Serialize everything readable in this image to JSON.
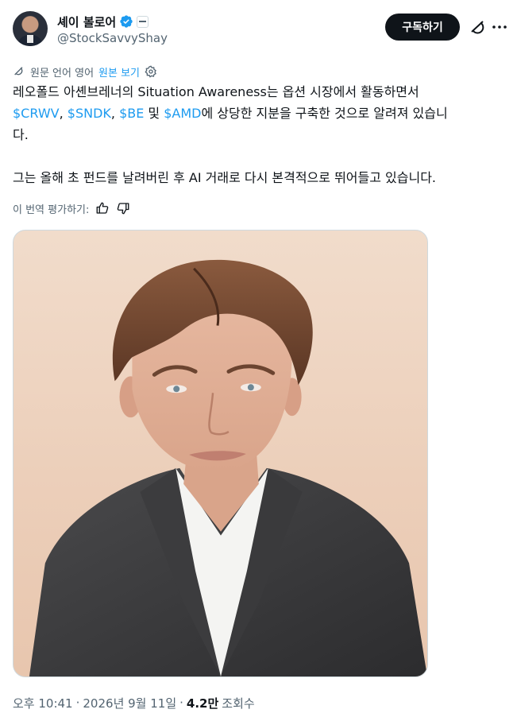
{
  "author": {
    "name": "셰이 볼로어",
    "handle": "@StockSavvyShay"
  },
  "actions": {
    "subscribe_label": "구독하기"
  },
  "translation": {
    "source_label": "원문 언어 영어",
    "show_original": "원본 보기"
  },
  "tweet": {
    "line1": "레오폴드 아셴브레너의 Situation Awareness는 옵션 시장에서 활동하면서",
    "cashtags": [
      "$CRWV",
      "$SNDK",
      "$BE",
      "$AMD"
    ],
    "sep_comma": ", ",
    "and_word": " 및 ",
    "line2_tail": "에 상당한 지분을 구축한 것으로 알려져 있습니",
    "line3": "다.",
    "paragraph2": "그는 올해 초 펀드를 날려버린 후 AI 거래로 다시 본격적으로 뛰어들고 있습니다."
  },
  "rate": {
    "label": "이 번역 평가하기:"
  },
  "meta": {
    "time": "오후 10:41",
    "dot": "·",
    "date": "2026년 9월 11일",
    "views_count": "4.2만",
    "views_label": "조회수"
  },
  "icons": {
    "verified": "verified-badge-icon",
    "affiliate": "affiliate-badge-icon",
    "grok": "grok-icon",
    "more": "more-icon",
    "translate": "translate-icon",
    "settings": "gear-icon",
    "like": "thumbs-up-icon",
    "dislike": "thumbs-down-icon"
  },
  "colors": {
    "accent": "#1d9bf0",
    "text": "#0f1419",
    "muted": "#536471",
    "button_bg": "#0f1419"
  }
}
